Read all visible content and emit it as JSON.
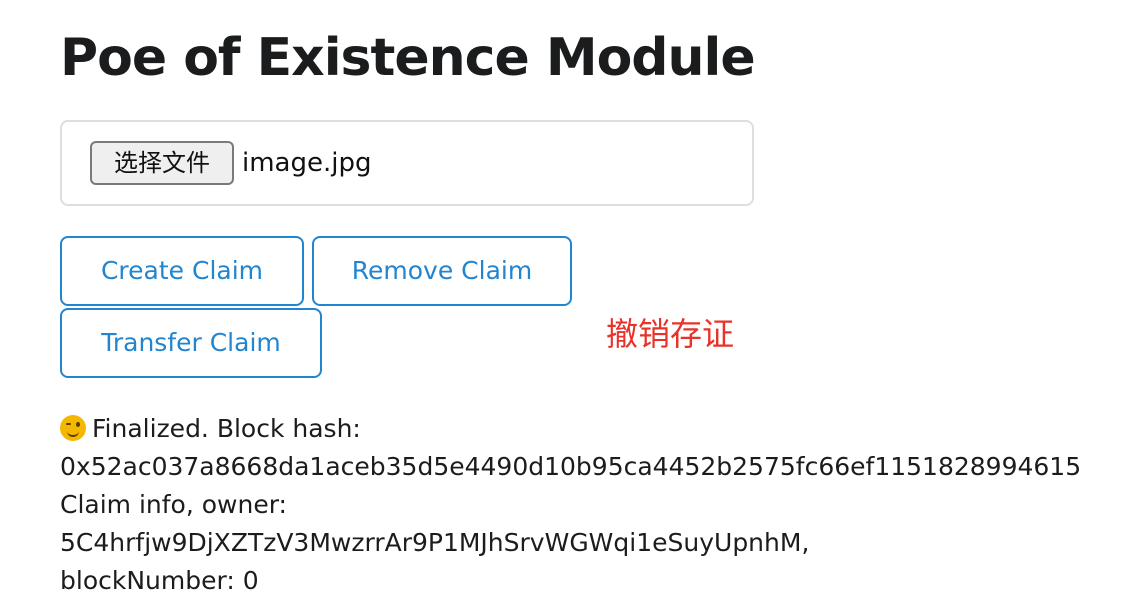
{
  "page": {
    "title": "Poe of Existence Module"
  },
  "file_input": {
    "button_label": "选择文件",
    "file_name": "image.jpg"
  },
  "buttons": {
    "create": "Create Claim",
    "remove": "Remove Claim",
    "transfer": "Transfer Claim"
  },
  "annotation": {
    "text": "撤销存证",
    "color": "#e8322a"
  },
  "status": {
    "icon": "winking-face-icon",
    "finalized": "Finalized. Block hash:",
    "block_hash": "0x52ac037a8668da1aceb35d5e4490d10b95ca4452b2575fc66ef1151828994615",
    "claim_info": "Claim info, owner:",
    "owner": "5C4hrfjw9DjXZTzV3MwzrrAr9P1MJhSrvWGWqi1eSuyUpnhM,",
    "block_number": "blockNumber: 0"
  },
  "colors": {
    "accent": "#2185d0",
    "text": "#1b1c1d",
    "border": "#dedede"
  }
}
